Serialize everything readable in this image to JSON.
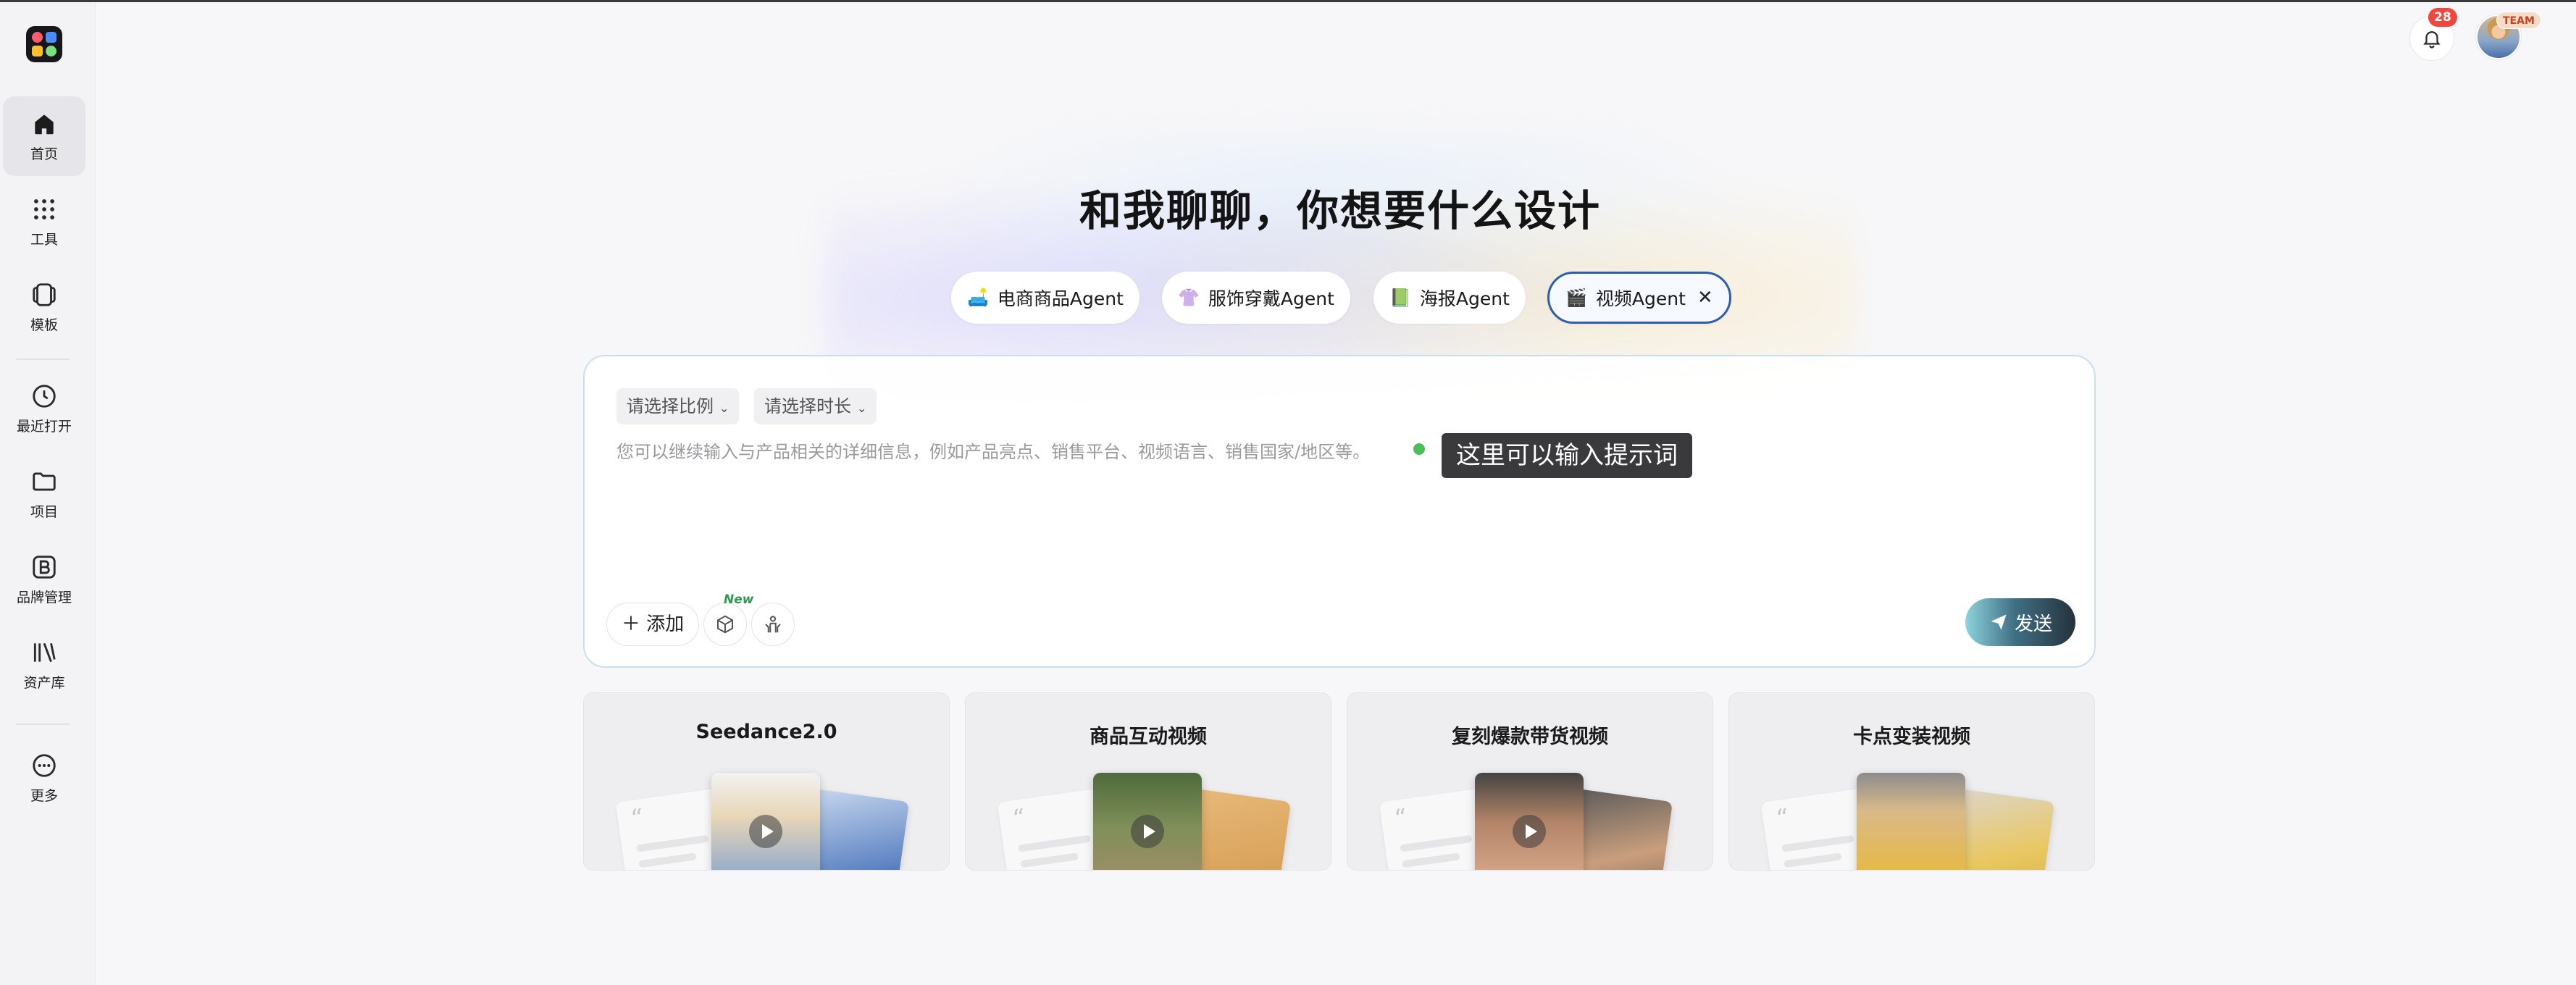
{
  "sidebar": {
    "items": [
      {
        "label": "首页",
        "icon": "home-icon"
      },
      {
        "label": "工具",
        "icon": "grid-icon"
      },
      {
        "label": "模板",
        "icon": "template-icon"
      },
      {
        "label": "最近打开",
        "icon": "clock-icon"
      },
      {
        "label": "项目",
        "icon": "folder-icon"
      },
      {
        "label": "品牌管理",
        "icon": "brand-icon"
      },
      {
        "label": "资产库",
        "icon": "library-icon"
      },
      {
        "label": "更多",
        "icon": "more-icon"
      }
    ]
  },
  "header": {
    "notification_count": "28",
    "team_label": "TEAM"
  },
  "main": {
    "headline": "和我聊聊，你想要什么设计",
    "agents": [
      {
        "label": "电商商品Agent",
        "icon": "🛋️"
      },
      {
        "label": "服饰穿戴Agent",
        "icon": "👚"
      },
      {
        "label": "海报Agent",
        "icon": "📗"
      },
      {
        "label": "视频Agent",
        "icon": "🎬"
      }
    ],
    "active_agent_close": "✕"
  },
  "composer": {
    "ratio_select": "请选择比例",
    "duration_select": "请选择时长",
    "placeholder": "您可以继续输入与产品相关的详细信息，例如产品亮点、销售平台、视频语言、销售国家/地区等。",
    "tooltip": "这里可以输入提示词",
    "add_label": "添加",
    "new_tag": "New",
    "send_label": "发送"
  },
  "cards": [
    {
      "title": "Seedance2.0"
    },
    {
      "title": "商品互动视频"
    },
    {
      "title": "复刻爆款带货视频"
    },
    {
      "title": "卡点变装视频"
    }
  ],
  "colors": {
    "accent": "#2d5fa8",
    "badge": "#f0473d",
    "cursor_dot": "#4bbf5a"
  }
}
